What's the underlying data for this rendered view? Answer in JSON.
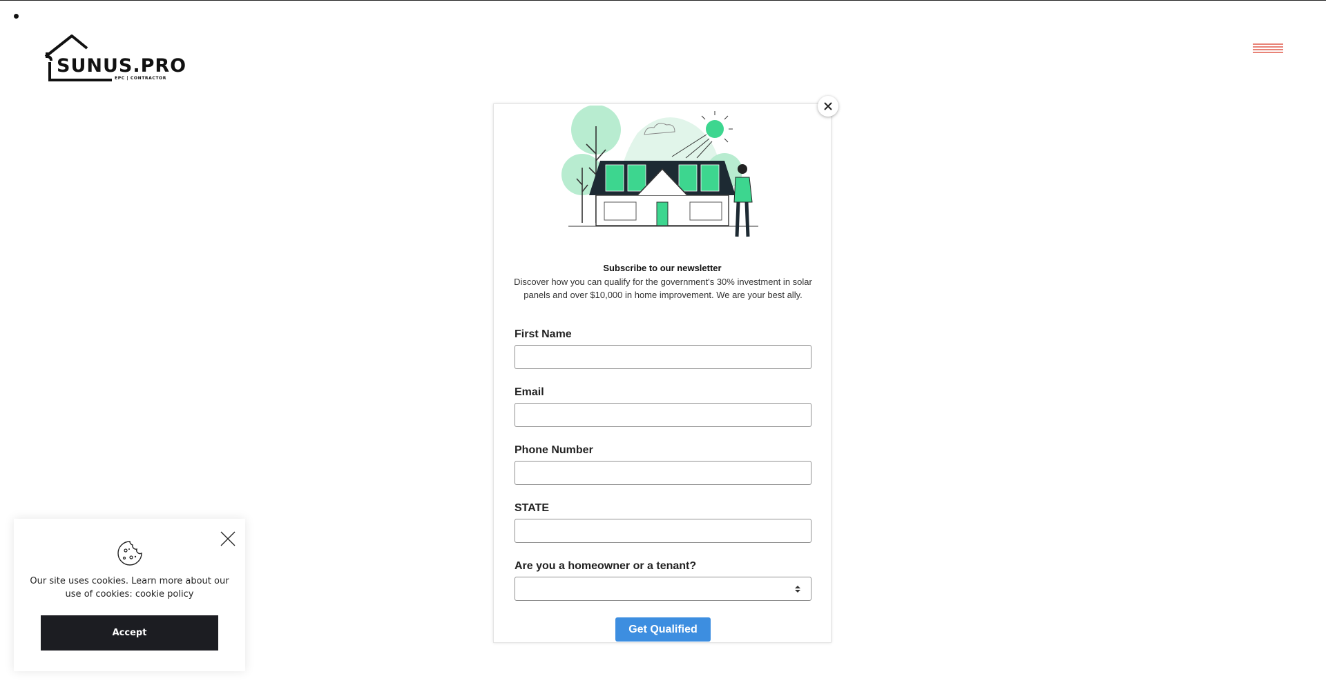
{
  "header": {
    "logo_text": "SUNUS.PRO",
    "logo_subtext": "EPC | CONTRACTOR",
    "menu_icon": "hamburger-menu-icon",
    "menu_color": "#e05a4a"
  },
  "popup": {
    "illustration": "solar-house-illustration",
    "title": "Subscribe to our newsletter",
    "description": "Discover how you can qualify for the government's 30% investment in solar panels and over $10,000 in home improvement. We are your best ally.",
    "close_icon": "close-icon",
    "fields": [
      {
        "label": "First Name",
        "value": ""
      },
      {
        "label": "Email",
        "value": ""
      },
      {
        "label": "Phone Number",
        "value": ""
      },
      {
        "label": "STATE",
        "value": ""
      },
      {
        "label": "Are you a homeowner or a tenant?",
        "value": ""
      }
    ],
    "submit_label": "Get Qualified",
    "submit_color": "#3d8ee0"
  },
  "cookie_banner": {
    "icon": "cookie-icon",
    "text": "Our site uses cookies. Learn more about our use of cookies: cookie policy",
    "accept_label": "Accept"
  }
}
